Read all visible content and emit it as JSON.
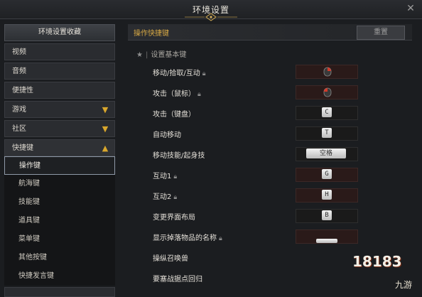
{
  "window": {
    "title": "环境设置",
    "close_icon": "close-icon"
  },
  "sidebar": {
    "header": "环境设置收藏",
    "items": [
      {
        "label": "视频",
        "expanded": false
      },
      {
        "label": "音频",
        "expanded": false
      },
      {
        "label": "便捷性",
        "expanded": false
      },
      {
        "label": "游戏",
        "expanded": false,
        "chevron": "chevron-down-icon"
      },
      {
        "label": "社区",
        "expanded": false,
        "chevron": "chevron-down-icon"
      },
      {
        "label": "快捷键",
        "expanded": true,
        "chevron": "chevron-up-icon"
      }
    ],
    "subitems": [
      {
        "label": "操作键",
        "active": true
      },
      {
        "label": "航海键",
        "active": false
      },
      {
        "label": "技能键",
        "active": false
      },
      {
        "label": "道具键",
        "active": false
      },
      {
        "label": "菜单键",
        "active": false
      },
      {
        "label": "其他按键",
        "active": false
      },
      {
        "label": "快捷发言键",
        "active": false
      }
    ]
  },
  "main": {
    "title": "操作快捷键",
    "reset_label": "重置",
    "section_title": "设置基本键",
    "rows": [
      {
        "label": "移动/拾取/互动",
        "locked": true,
        "key": "mouse-right-icon"
      },
      {
        "label": "攻击（鼠标）",
        "locked": true,
        "key": "mouse-left-icon"
      },
      {
        "label": "攻击（键盘）",
        "locked": false,
        "key": "C"
      },
      {
        "label": "自动移动",
        "locked": false,
        "key": "T"
      },
      {
        "label": "移动技能/起身技",
        "locked": false,
        "key": "空格"
      },
      {
        "label": "互动1",
        "locked": true,
        "key": "G"
      },
      {
        "label": "互动2",
        "locked": true,
        "key": "H"
      },
      {
        "label": "变更界面布局",
        "locked": false,
        "key": "B"
      },
      {
        "label": "显示掉落物品的名称",
        "locked": true,
        "key": ""
      },
      {
        "label": "操纵召唤兽",
        "locked": false,
        "key": ""
      },
      {
        "label": "要塞战据点回归",
        "locked": false,
        "key": ""
      }
    ]
  },
  "watermark": {
    "text": "18183",
    "sub": "九游"
  },
  "colors": {
    "accent": "#d8a945",
    "chevron": "#d9a72c",
    "keybox_red": "#2a1a19"
  }
}
